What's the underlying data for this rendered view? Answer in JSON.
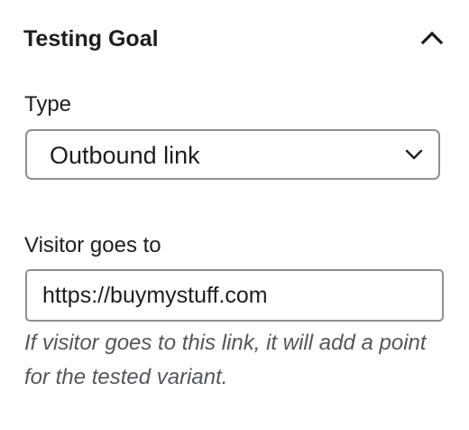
{
  "panel": {
    "title": "Testing Goal",
    "toggle_icon": "chevron-up-icon",
    "expanded": true
  },
  "type_field": {
    "label": "Type",
    "selected_value": "Outbound link",
    "dropdown_icon": "chevron-down-icon"
  },
  "destination_field": {
    "label": "Visitor goes to",
    "value": "https://buymystuff.com",
    "help_text": "If visitor goes to this link, it will add a point for the tested variant."
  },
  "colors": {
    "text": "#1e1e1e",
    "border": "#8c8f94",
    "help_text": "#50575e",
    "background": "#ffffff"
  }
}
